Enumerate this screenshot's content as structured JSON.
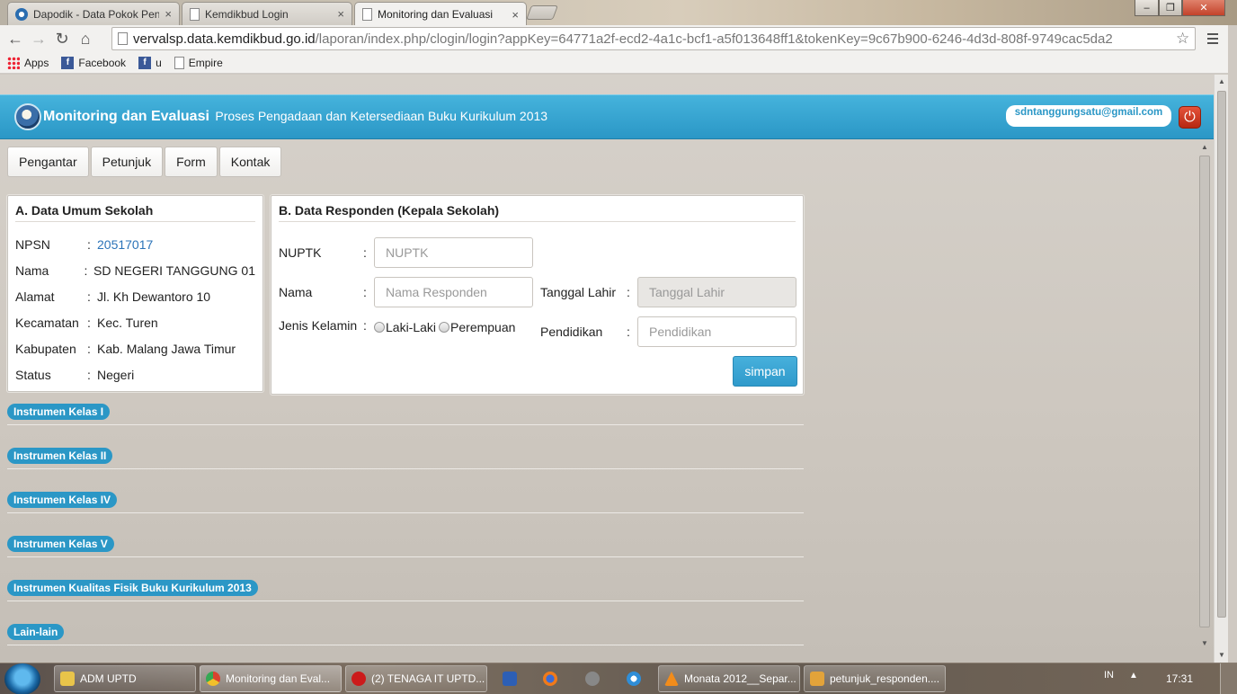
{
  "browser": {
    "tabs": [
      {
        "title": "Dapodik - Data Pokok Pen",
        "close": "×",
        "active": false
      },
      {
        "title": "Kemdikbud Login",
        "close": "×",
        "active": false
      },
      {
        "title": "Monitoring dan Evaluasi",
        "close": "×",
        "active": true
      }
    ],
    "window_buttons": {
      "minimize": "–",
      "maximize": "❐",
      "close": "✕"
    },
    "url_host": "vervalsp.data.kemdikbud.go.id",
    "url_path": "/laporan/index.php/clogin/login?appKey=64771a2f-ecd2-4a1c-bcf1-a5f013648ff1&tokenKey=9c67b900-6246-4d3d-808f-9749cac5da2",
    "bookmarks": [
      {
        "label": "Apps",
        "icon": "apps-grid-icon"
      },
      {
        "label": "Facebook",
        "icon": "facebook-icon"
      },
      {
        "label": "u",
        "icon": "facebook-icon"
      },
      {
        "label": "Empire",
        "icon": "page-icon"
      }
    ]
  },
  "header": {
    "title": "Monitoring dan Evaluasi",
    "subtitle": "Proses Pengadaan dan Ketersediaan Buku Kurikulum 2013",
    "user_email": "sdntanggungsatu@gmail.com",
    "accent_color": "#2b97c6"
  },
  "nav": [
    "Pengantar",
    "Petunjuk",
    "Form",
    "Kontak"
  ],
  "school": {
    "title": "A. Data Umum Sekolah",
    "rows": [
      {
        "label": "NPSN",
        "sep": ":",
        "value": "20517017"
      },
      {
        "label": "Nama",
        "sep": ":",
        "value": "SD NEGERI TANGGUNG 01"
      },
      {
        "label": "Alamat",
        "sep": ":",
        "value": "Jl. Kh Dewantoro 10"
      },
      {
        "label": "Kecamatan",
        "sep": ":",
        "value": "Kec. Turen"
      },
      {
        "label": "Kabupaten",
        "sep": ":",
        "value": "Kab. Malang Jawa Timur"
      },
      {
        "label": "Status",
        "sep": ":",
        "value": "Negeri"
      }
    ]
  },
  "respondent": {
    "title": "B. Data Responden (Kepala Sekolah)",
    "nuptk_label": "NUPTK",
    "nuptk_placeholder": "NUPTK",
    "nama_label": "Nama",
    "nama_placeholder": "Nama Responden",
    "tgl_label": "Tanggal Lahir",
    "tgl_placeholder": "Tanggal Lahir",
    "jk_label": "Jenis Kelamin",
    "jk_options": [
      "Laki-Laki",
      "Perempuan"
    ],
    "pend_label": "Pendidikan",
    "pend_placeholder": "Pendidikan",
    "sep": ":",
    "submit_label": "simpan"
  },
  "instruments": [
    "Instrumen Kelas I",
    "Instrumen Kelas II",
    "Instrumen Kelas IV",
    "Instrumen Kelas V",
    "Instrumen Kualitas Fisik Buku Kurikulum 2013",
    "Lain-lain"
  ],
  "taskbar": {
    "tasks": [
      {
        "label": "ADM UPTD",
        "icon": "folder-icon",
        "color": "#e8c44a"
      },
      {
        "label": "Monitoring dan Eval...",
        "icon": "chrome-icon",
        "color": "#d9432f"
      },
      {
        "label": "(2) TENAGA IT UPTD...",
        "icon": "opera-icon",
        "color": "#cc1b1b"
      },
      {
        "label": "Monata 2012__Separ...",
        "icon": "vlc-icon",
        "color": "#f28c1a"
      },
      {
        "label": "petunjuk_responden....",
        "icon": "paint-icon",
        "color": "#e2a33a"
      }
    ],
    "lang": "IN",
    "tray_arrow": "▲",
    "clock": "17:31"
  }
}
